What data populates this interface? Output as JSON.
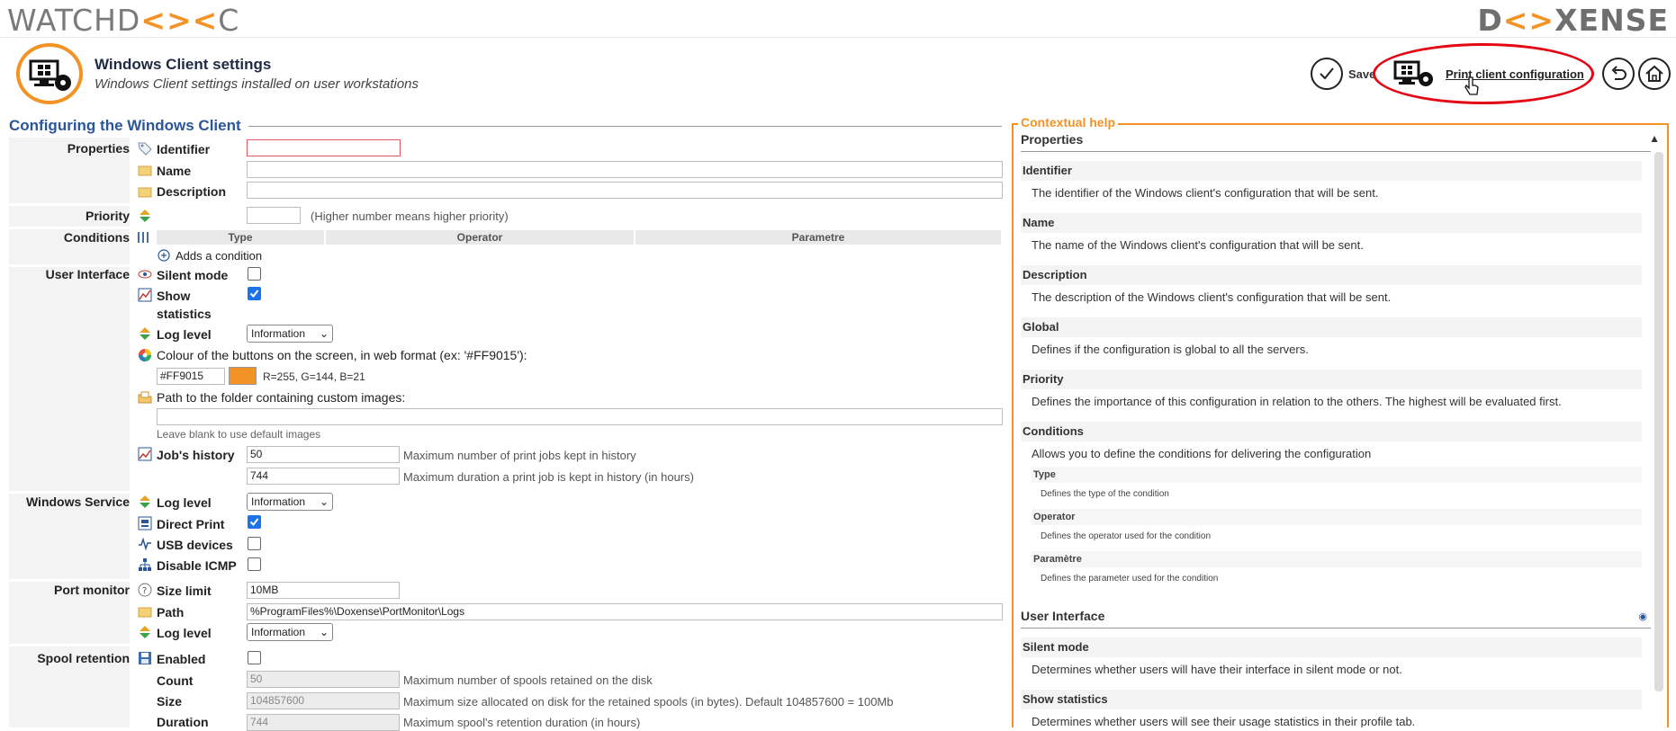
{
  "brand": {
    "left": [
      "WATCHD",
      "C"
    ],
    "right": [
      "D",
      "XENSE"
    ],
    "accent": "#f39325"
  },
  "header": {
    "title": "Windows Client settings",
    "subtitle": "Windows Client settings installed on user workstations",
    "save_label": "Save",
    "print_config_label": "Print client configuration",
    "highlight_color": "#e30613"
  },
  "form": {
    "section_title": "Configuring the Windows Client",
    "groups": {
      "properties": "Properties",
      "priority": "Priority",
      "conditions": "Conditions",
      "user_interface": "User Interface",
      "windows_service": "Windows Service",
      "port_monitor": "Port monitor",
      "spool_retention": "Spool retention"
    },
    "properties": {
      "identifier": "Identifier",
      "name": "Name",
      "description": "Description"
    },
    "priority_hint": "(Higher number means higher priority)",
    "conditions": {
      "col_type": "Type",
      "col_operator": "Operator",
      "col_parametre": "Parametre",
      "add": "Adds a condition"
    },
    "ui": {
      "silent_mode": "Silent mode",
      "show_statistics_1": "Show",
      "show_statistics_2": "statistics",
      "show_statistics_checked": true,
      "log_level": "Log level",
      "log_level_value": "Information",
      "colour_label": "Colour of the buttons on the screen, in web format (ex: '#FF9015'):",
      "colour_value": "#FF9015",
      "colour_swatch": "#f39325",
      "colour_rgb": "R=255, G=144, B=21",
      "images_label": "Path to the folder containing custom images:",
      "images_hint": "Leave blank to use default images",
      "history_label": "Job's history",
      "history_count": "50",
      "history_count_hint": "Maximum number of print jobs kept in history",
      "history_duration": "744",
      "history_duration_hint": "Maximum duration a print job is kept in history (in hours)"
    },
    "service": {
      "log_level": "Log level",
      "log_level_value": "Information",
      "direct_print": "Direct Print",
      "direct_print_checked": true,
      "usb": "USB devices",
      "icmp": "Disable ICMP"
    },
    "port": {
      "size_limit": "Size limit",
      "size_limit_value": "10MB",
      "path": "Path",
      "path_value": "%ProgramFiles%\\Doxense\\PortMonitor\\Logs",
      "log_level": "Log level",
      "log_level_value": "Information"
    },
    "spool": {
      "enabled": "Enabled",
      "count": "Count",
      "count_value": "50",
      "count_hint": "Maximum number of spools retained on the disk",
      "size": "Size",
      "size_value": "104857600",
      "size_hint": "Maximum size allocated on disk for the retained spools (in bytes). Default 104857600 = 100Mb",
      "duration": "Duration",
      "duration_value": "744",
      "duration_hint": "Maximum spool's retention duration (in hours)"
    }
  },
  "help": {
    "title": "Contextual help",
    "properties_title": "Properties",
    "identifier": "Identifier",
    "identifier_desc": "The identifier of the Windows client's configuration that will be sent.",
    "name": "Name",
    "name_desc": "The name of the Windows client's configuration that will be sent.",
    "description": "Description",
    "description_desc": "The description of the Windows client's configuration that will be sent.",
    "global": "Global",
    "global_desc": "Defines if the configuration is global to all the servers.",
    "priority": "Priority",
    "priority_desc": "Defines the importance of this configuration in relation to the others. The highest will be evaluated first.",
    "conditions": "Conditions",
    "conditions_desc": "Allows you to define the conditions for delivering the configuration",
    "type": "Type",
    "type_desc": "Defines the type of the condition",
    "operator": "Operator",
    "operator_desc": "Defines the operator used for the condition",
    "parametre": "Paramètre",
    "parametre_desc": "Defines the parameter used for the condition",
    "ui_title": "User Interface",
    "silent": "Silent mode",
    "silent_desc": "Determines whether users will have their interface in silent mode or not.",
    "stats": "Show statistics",
    "stats_desc": "Determines whether users will see their usage statistics in their profile tab."
  }
}
